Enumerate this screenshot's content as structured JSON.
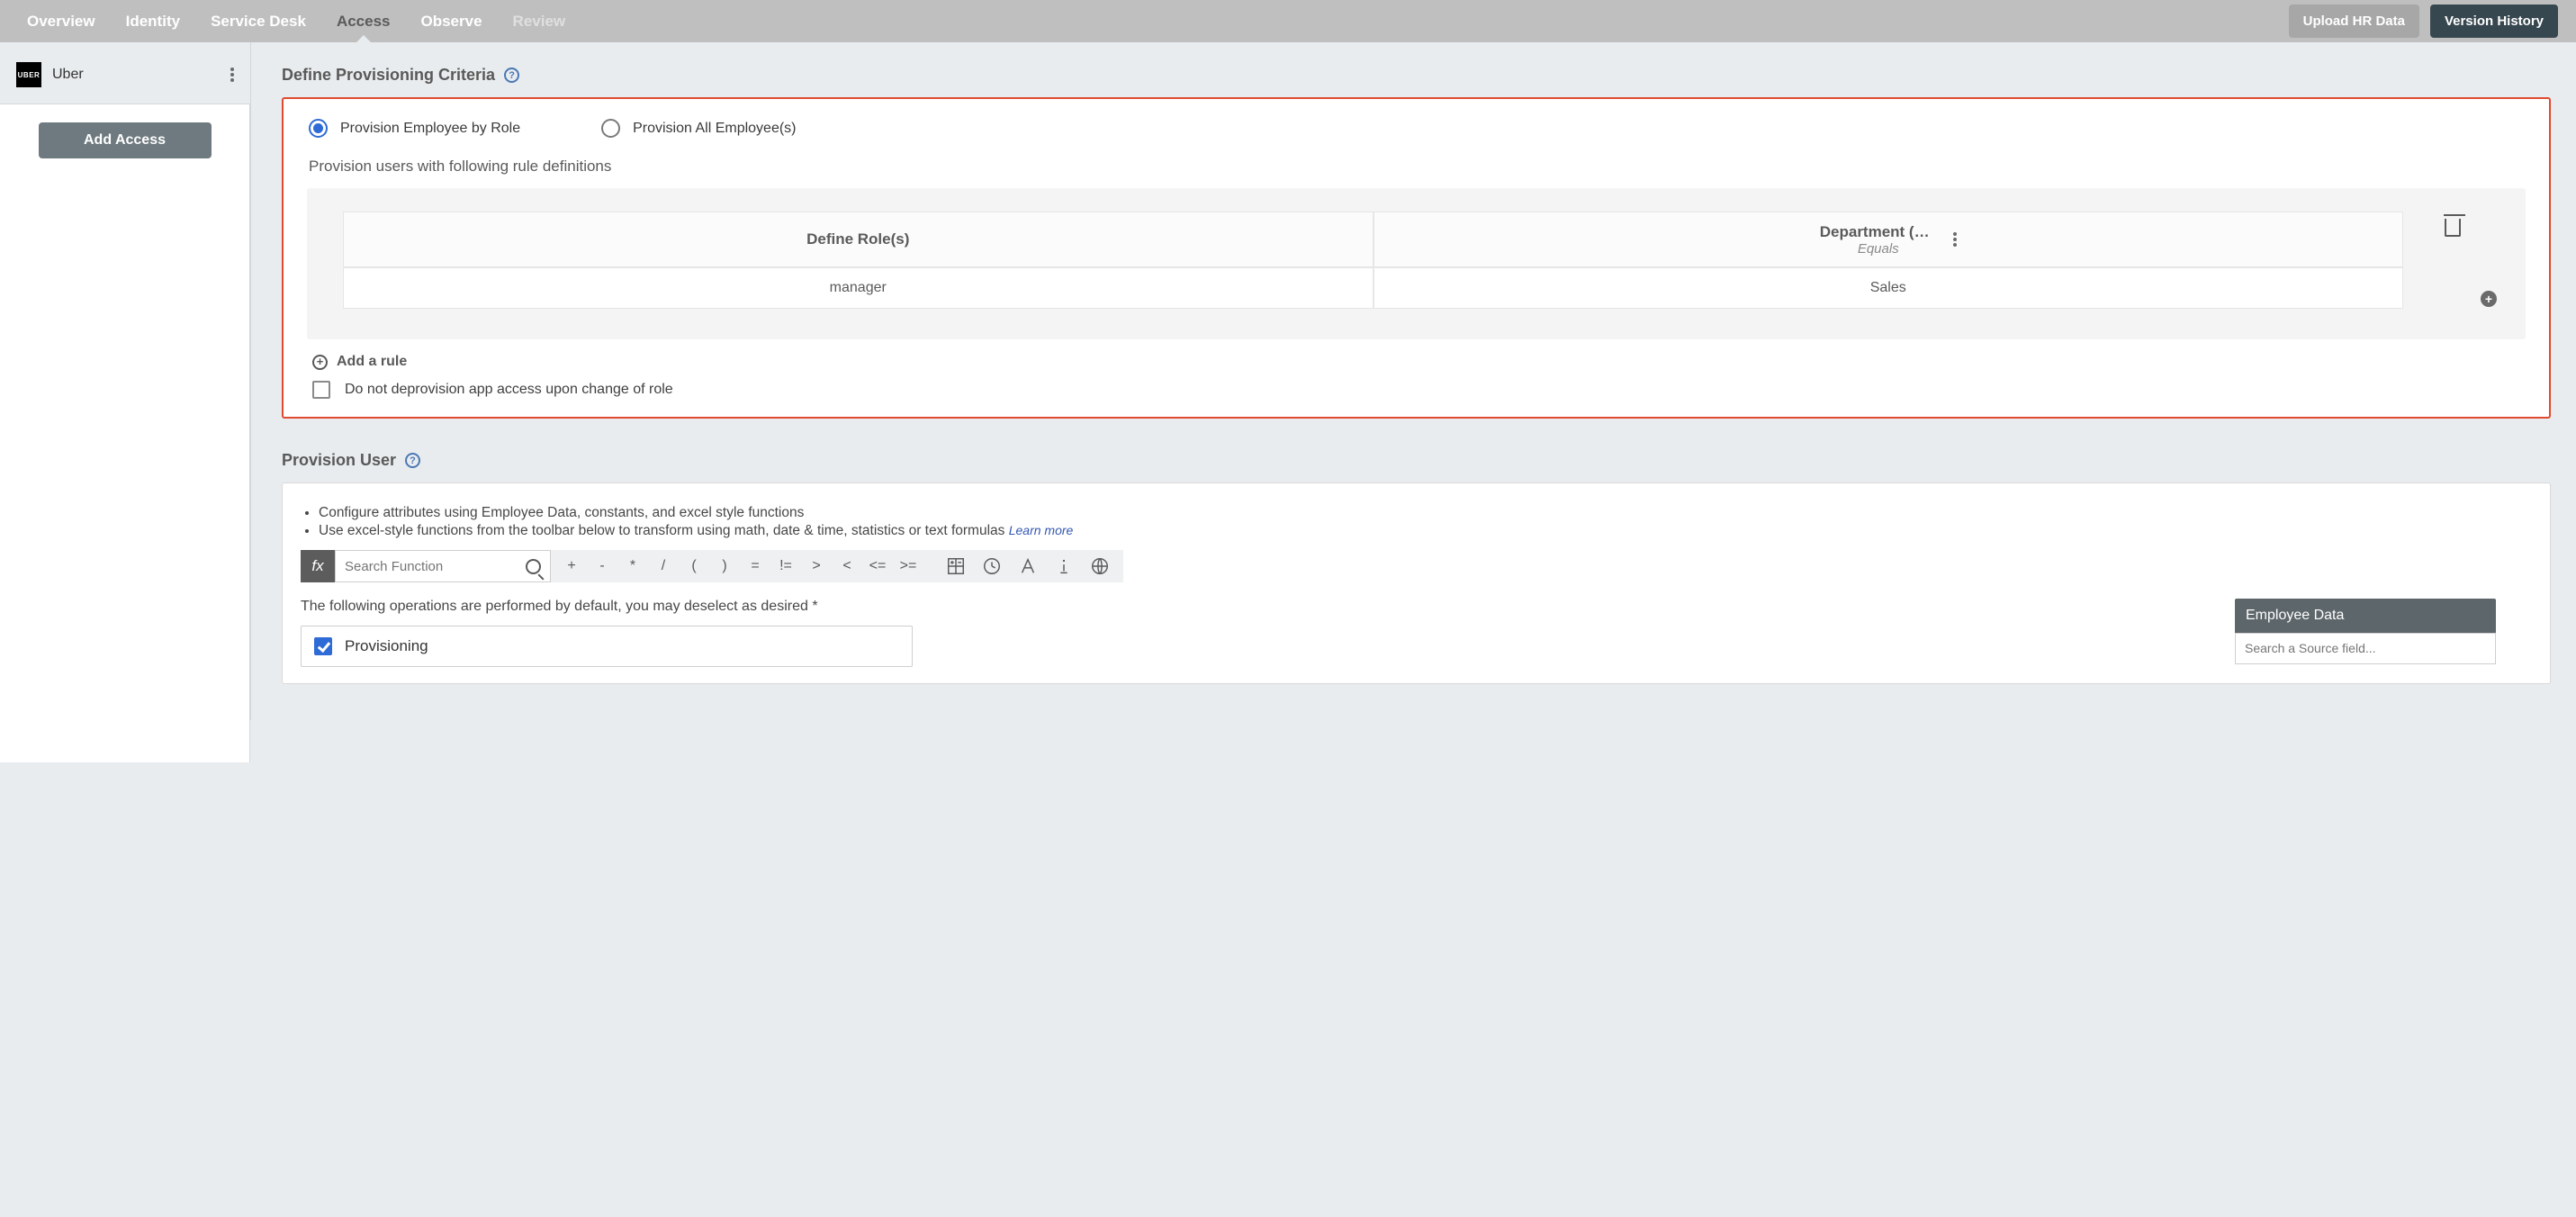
{
  "topTabs": {
    "overview": "Overview",
    "identity": "Identity",
    "serviceDesk": "Service Desk",
    "access": "Access",
    "observe": "Observe",
    "review": "Review"
  },
  "topButtons": {
    "uploadHr": "Upload HR Data",
    "versionHistory": "Version History"
  },
  "sidebar": {
    "orgLogoText": "UBER",
    "orgName": "Uber",
    "addAccess": "Add Access"
  },
  "criteria": {
    "heading": "Define Provisioning Criteria",
    "radioByRole": "Provision Employee by Role",
    "radioAllEmployees": "Provision All Employee(s)",
    "ruleIntro": "Provision users with following rule definitions",
    "table": {
      "defineRolesHeader": "Define Role(s)",
      "col2Title": "Department (de…",
      "col2Sub": "Equals",
      "roleValue": "manager",
      "deptValue": "Sales"
    },
    "addRule": "Add a rule",
    "noDeprovision": "Do not deprovision app access upon change of role"
  },
  "provisionUser": {
    "heading": "Provision User",
    "bullet1": "Configure attributes using Employee Data, constants, and excel style functions",
    "bullet2": "Use excel-style functions from the toolbar below to transform using math, date & time, statistics or text formulas",
    "learnMore": "Learn more",
    "fxLabel": "fx",
    "searchPlaceholder": "Search Function",
    "ops": {
      "plus": "+",
      "minus": "-",
      "times": "*",
      "div": "/",
      "lparen": "(",
      "rparen": ")",
      "eq": "=",
      "neq": "!=",
      "gt": ">",
      "lt": "<",
      "lte": "<=",
      "gte": ">="
    },
    "operationsDesc": "The following operations are performed by default, you may deselect as desired *",
    "provisioningLabel": "Provisioning"
  },
  "employeeData": {
    "header": "Employee Data",
    "searchPlaceholder": "Search a Source field..."
  }
}
